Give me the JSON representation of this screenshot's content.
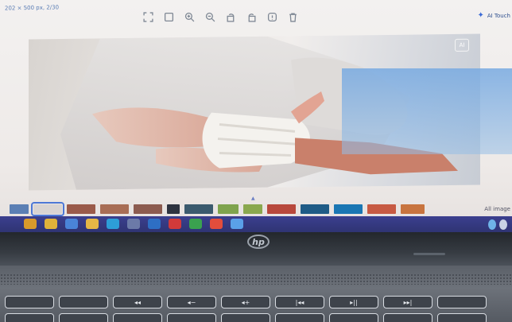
{
  "screen": {
    "dimensions_label": "202 × 500 px, 2/30",
    "toolbar": [
      {
        "icon": "fullscreen-icon"
      },
      {
        "icon": "fit-icon"
      },
      {
        "icon": "zoom-in-icon"
      },
      {
        "icon": "zoom-out-icon"
      },
      {
        "icon": "rotate-left-icon"
      },
      {
        "icon": "rotate-right-icon"
      },
      {
        "icon": "info-icon"
      },
      {
        "icon": "delete-icon"
      }
    ],
    "ai_touchup_label": "AI Touch",
    "ai_badge": "AI",
    "all_images_label": "All image",
    "filmstrip": [
      {
        "color": "#5b7fb4",
        "w": 24
      },
      {
        "color": "#d9d4d2",
        "w": 36,
        "selected": true
      },
      {
        "color": "#9a5a4a",
        "w": 36
      },
      {
        "color": "#a86d55",
        "w": 36
      },
      {
        "color": "#8c5b4f",
        "w": 36
      },
      {
        "color": "#2e3340",
        "w": 16
      },
      {
        "color": "#3b5a6e",
        "w": 36
      },
      {
        "color": "#7fa34d",
        "w": 26
      },
      {
        "color": "#8aa84e",
        "w": 24
      },
      {
        "color": "#b8483c",
        "w": 36
      },
      {
        "color": "#1f5b86",
        "w": 36
      },
      {
        "color": "#1a76b3",
        "w": 36
      },
      {
        "color": "#c75a43",
        "w": 36
      },
      {
        "color": "#c8743f",
        "w": 30
      }
    ],
    "taskbar_icons": [
      {
        "name": "file-explorer-icon",
        "color": "#d99a2b"
      },
      {
        "name": "chrome-icon",
        "color": "#e0b23a"
      },
      {
        "name": "store-icon",
        "color": "#4a84d8"
      },
      {
        "name": "folder-icon",
        "color": "#e5b746"
      },
      {
        "name": "edge-icon",
        "color": "#2d9ed8"
      },
      {
        "name": "settings-icon",
        "color": "#6c7aa8"
      },
      {
        "name": "mail-icon",
        "color": "#2e6fc4"
      },
      {
        "name": "opera-icon",
        "color": "#d23a3a"
      },
      {
        "name": "chat-icon",
        "color": "#3aa14f"
      },
      {
        "name": "chrome-2-icon",
        "color": "#e24d3c"
      },
      {
        "name": "photos-icon",
        "color": "#5aa0e8"
      }
    ]
  },
  "keyboard": {
    "row1": [
      "",
      "",
      "◂◂",
      "◂−",
      "◂+",
      "|◂◂",
      "▸||",
      "▸▸|",
      ""
    ],
    "row2": [
      "",
      "",
      "",
      "",
      "",
      "",
      "",
      "",
      ""
    ]
  },
  "brand": "hp"
}
